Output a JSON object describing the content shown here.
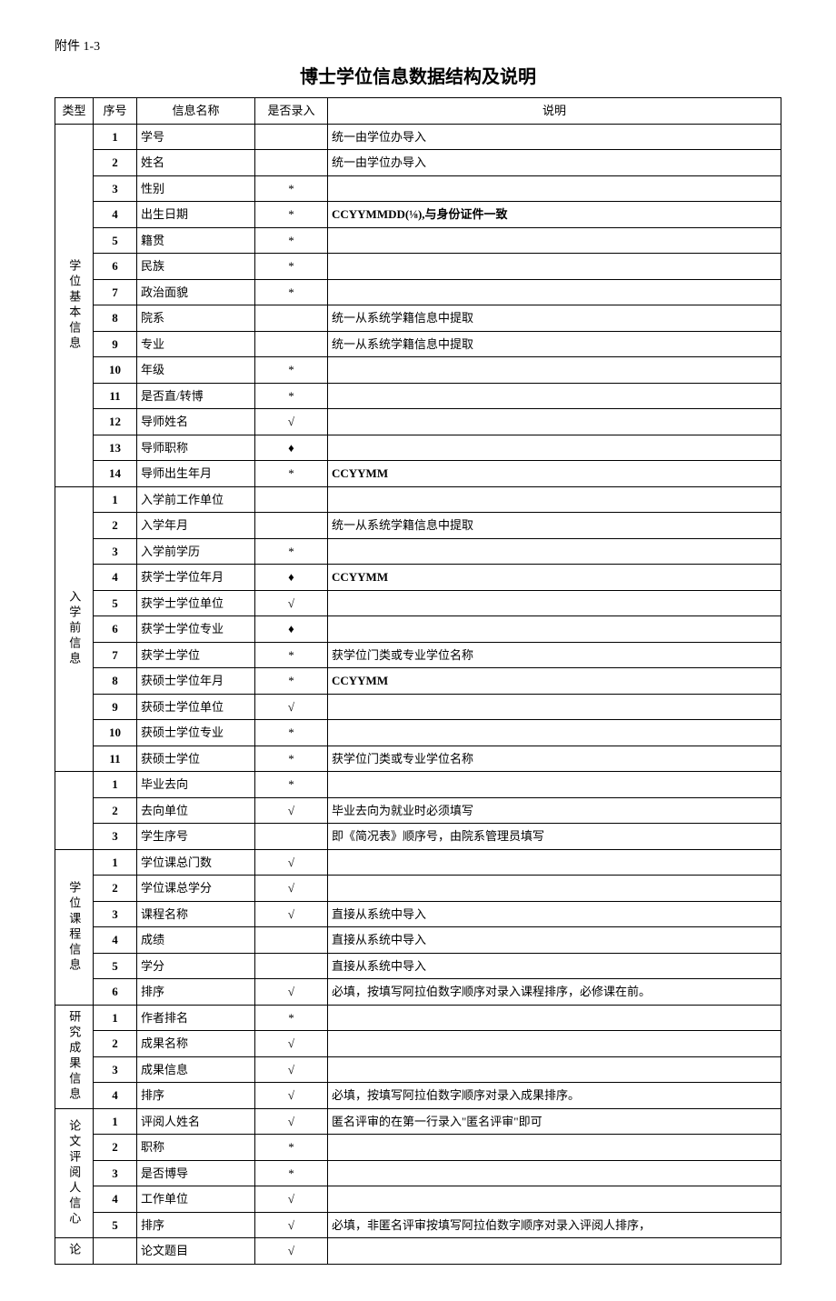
{
  "attachment": "附件 1-3",
  "title": "博士学位信息数据结构及说明",
  "headers": {
    "type": "类型",
    "seq": "序号",
    "name": "信息名称",
    "input": "是否录入",
    "desc": "说明"
  },
  "groups": [
    {
      "label": "学位基本信息",
      "rows": [
        {
          "seq": "1",
          "name": "学号",
          "input": "",
          "desc": "统一由学位办导入"
        },
        {
          "seq": "2",
          "name": "姓名",
          "input": "",
          "desc": "统一由学位办导入"
        },
        {
          "seq": "3",
          "name": "性别",
          "input": "*",
          "desc": ""
        },
        {
          "seq": "4",
          "name": "出生日期",
          "input": "*",
          "desc": "CCYYMMDD(⅛),与身份证件一致",
          "bold": true
        },
        {
          "seq": "5",
          "name": "籍贯",
          "input": "*",
          "desc": ""
        },
        {
          "seq": "6",
          "name": "民族",
          "input": "*",
          "desc": ""
        },
        {
          "seq": "7",
          "name": "政治面貌",
          "input": "*",
          "desc": ""
        },
        {
          "seq": "8",
          "name": "院系",
          "input": "",
          "desc": "统一从系统学籍信息中提取"
        },
        {
          "seq": "9",
          "name": "专业",
          "input": "",
          "desc": "统一从系统学籍信息中提取"
        },
        {
          "seq": "10",
          "name": "年级",
          "input": "*",
          "desc": ""
        },
        {
          "seq": "11",
          "name": "是否直/转博",
          "input": "*",
          "desc": ""
        },
        {
          "seq": "12",
          "name": "导师姓名",
          "input": "√",
          "desc": ""
        },
        {
          "seq": "13",
          "name": "导师职称",
          "input": "♦",
          "desc": ""
        },
        {
          "seq": "14",
          "name": "导师出生年月",
          "input": "*",
          "desc": "CCYYMM",
          "bold": true
        }
      ]
    },
    {
      "label": "入学前信息",
      "rows": [
        {
          "seq": "1",
          "name": "入学前工作单位",
          "input": "",
          "desc": ""
        },
        {
          "seq": "2",
          "name": "入学年月",
          "input": "",
          "desc": "统一从系统学籍信息中提取"
        },
        {
          "seq": "3",
          "name": "入学前学历",
          "input": "*",
          "desc": ""
        },
        {
          "seq": "4",
          "name": "获学士学位年月",
          "input": "♦",
          "desc": "CCYYMM",
          "bold": true
        },
        {
          "seq": "5",
          "name": "获学士学位单位",
          "input": "√",
          "desc": ""
        },
        {
          "seq": "6",
          "name": "获学士学位专业",
          "input": "♦",
          "desc": ""
        },
        {
          "seq": "7",
          "name": "获学士学位",
          "input": "*",
          "desc": "获学位门类或专业学位名称"
        },
        {
          "seq": "8",
          "name": "获硕士学位年月",
          "input": "*",
          "desc": "CCYYMM",
          "bold": true
        },
        {
          "seq": "9",
          "name": "获硕士学位单位",
          "input": "√",
          "desc": ""
        },
        {
          "seq": "10",
          "name": "获硕士学位专业",
          "input": "*",
          "desc": ""
        },
        {
          "seq": "11",
          "name": "获硕士学位",
          "input": "*",
          "desc": "获学位门类或专业学位名称"
        }
      ]
    },
    {
      "label": "",
      "rows": [
        {
          "seq": "1",
          "name": "毕业去向",
          "input": "*",
          "desc": ""
        },
        {
          "seq": "2",
          "name": "去向单位",
          "input": "√",
          "desc": "毕业去向为就业时必须填写"
        },
        {
          "seq": "3",
          "name": "学生序号",
          "input": "",
          "desc": "即《简况表》顺序号，由院系管理员填写"
        }
      ]
    },
    {
      "label": "学位课程信息",
      "rows": [
        {
          "seq": "1",
          "name": "学位课总门数",
          "input": "√",
          "desc": ""
        },
        {
          "seq": "2",
          "name": "学位课总学分",
          "input": "√",
          "desc": ""
        },
        {
          "seq": "3",
          "name": "课程名称",
          "input": "√",
          "desc": "直接从系统中导入"
        },
        {
          "seq": "4",
          "name": "成绩",
          "input": "",
          "desc": "直接从系统中导入"
        },
        {
          "seq": "5",
          "name": "学分",
          "input": "",
          "desc": "直接从系统中导入"
        },
        {
          "seq": "6",
          "name": "排序",
          "input": "√",
          "desc": "必填，按填写阿拉伯数字顺序对录入课程排序，必修课在前。"
        }
      ]
    },
    {
      "label": "研究成果信息",
      "rows": [
        {
          "seq": "1",
          "name": "作者排名",
          "input": "*",
          "desc": ""
        },
        {
          "seq": "2",
          "name": "成果名称",
          "input": "√",
          "desc": ""
        },
        {
          "seq": "3",
          "name": "成果信息",
          "input": "√",
          "desc": ""
        },
        {
          "seq": "4",
          "name": "排序",
          "input": "√",
          "desc": "必填，按填写阿拉伯数字顺序对录入成果排序。"
        }
      ]
    },
    {
      "label": "论文评阅人信心",
      "rows": [
        {
          "seq": "1",
          "name": "评阅人姓名",
          "input": "√",
          "desc": "匿名评审的在第一行录入\"匿名评审\"即可"
        },
        {
          "seq": "2",
          "name": "职称",
          "input": "*",
          "desc": ""
        },
        {
          "seq": "3",
          "name": "是否博导",
          "input": "*",
          "desc": ""
        },
        {
          "seq": "4",
          "name": "工作单位",
          "input": "√",
          "desc": ""
        },
        {
          "seq": "5",
          "name": "排序",
          "input": "√",
          "desc": "必填，非匿名评审按填写阿拉伯数字顺序对录入评阅人排序，"
        }
      ]
    },
    {
      "label": "论",
      "rows": [
        {
          "seq": "",
          "name": "论文题目",
          "input": "√",
          "desc": ""
        }
      ]
    }
  ]
}
